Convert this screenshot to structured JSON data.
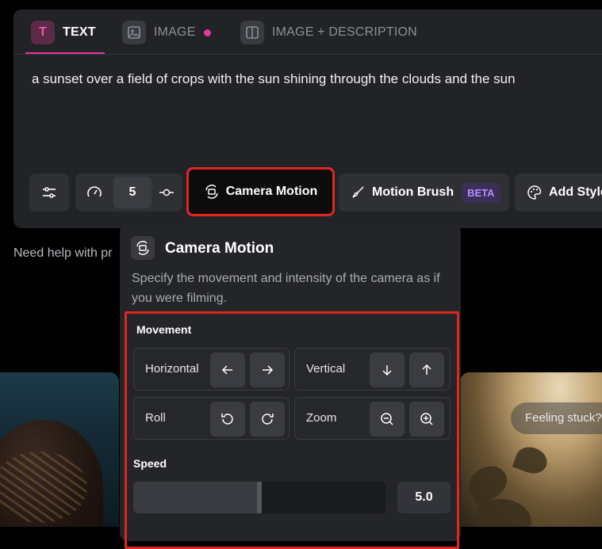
{
  "tabs": [
    {
      "label": "TEXT",
      "icon": "text-icon",
      "active": true
    },
    {
      "label": "IMAGE",
      "icon": "image-icon",
      "has_dot": true
    },
    {
      "label": "IMAGE + DESCRIPTION",
      "icon": "split-view-icon"
    }
  ],
  "tab_text_glyph": "T",
  "prompt_text": "a sunset over a field of crops with the sun shining through the clouds and the sun",
  "toolbar": {
    "motion_value": "5",
    "camera_motion_label": "Camera Motion",
    "motion_brush_label": "Motion Brush",
    "beta_badge": "BETA",
    "add_style_label": "Add Style"
  },
  "help_text": "Need help with pr",
  "feeling_stuck": "Feeling stuck?",
  "popup": {
    "title": "Camera Motion",
    "description": "Specify the movement and intensity of the camera as if you were filming.",
    "movement_label": "Movement",
    "controls": [
      {
        "label": "Horizontal",
        "buttons": [
          "arrow-left-icon",
          "arrow-right-icon"
        ]
      },
      {
        "label": "Vertical",
        "buttons": [
          "arrow-down-icon",
          "arrow-up-icon"
        ]
      },
      {
        "label": "Roll",
        "buttons": [
          "rotate-ccw-icon",
          "rotate-cw-icon"
        ]
      },
      {
        "label": "Zoom",
        "buttons": [
          "zoom-out-icon",
          "zoom-in-icon"
        ]
      }
    ],
    "speed_label": "Speed",
    "speed_value": "5.0",
    "speed_fraction": 0.5
  },
  "colors": {
    "accent_pink": "#e0379a",
    "highlight_red": "#e0271e",
    "beta_purple": "#b48cff"
  }
}
